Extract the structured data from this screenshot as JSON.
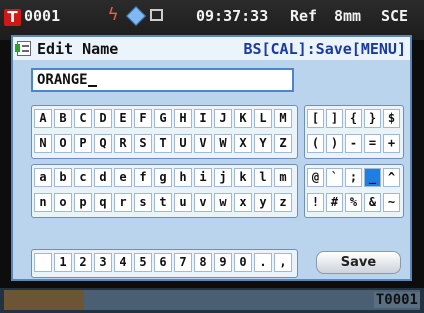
{
  "status_bar": {
    "badge": "T",
    "id": "0001",
    "time": "09:37:33",
    "ref": "Ref",
    "aperture": "8mm",
    "mode": "SCE",
    "icons": [
      "battery-lightning-icon",
      "diamond-sync-icon",
      "printer-icon"
    ],
    "colors": {
      "badge": "#d01818",
      "bolt": "#ff5555",
      "diamond": "#7fb8f2"
    }
  },
  "dialog": {
    "title": "Edit Name",
    "hint": "BS[CAL]:Save[MENU]",
    "name_value": "ORANGE",
    "save_label": "Save"
  },
  "keyboard": {
    "upper_row1": [
      "A",
      "B",
      "C",
      "D",
      "E",
      "F",
      "G",
      "H",
      "I",
      "J",
      "K",
      "L",
      "M"
    ],
    "upper_row2": [
      "N",
      "O",
      "P",
      "Q",
      "R",
      "S",
      "T",
      "U",
      "V",
      "W",
      "X",
      "Y",
      "Z"
    ],
    "lower_row1": [
      "a",
      "b",
      "c",
      "d",
      "e",
      "f",
      "g",
      "h",
      "i",
      "j",
      "k",
      "l",
      "m"
    ],
    "lower_row2": [
      "n",
      "o",
      "p",
      "q",
      "r",
      "s",
      "t",
      "u",
      "v",
      "w",
      "x",
      "y",
      "z"
    ],
    "digit_row": [
      " ",
      "1",
      "2",
      "3",
      "4",
      "5",
      "6",
      "7",
      "8",
      "9",
      "0",
      ".",
      ","
    ],
    "sym_row1": [
      "[",
      "]",
      "{",
      "}",
      "$"
    ],
    "sym_row2": [
      "(",
      ")",
      "-",
      "=",
      "+"
    ],
    "sym_row3": [
      "@",
      "`",
      ";",
      "_",
      "^"
    ],
    "sym_row4": [
      "!",
      "#",
      "%",
      "&",
      "~"
    ],
    "selected_key": "_",
    "colors": {
      "selected": "#1f7fe0",
      "panel": "#eaf2fa"
    }
  },
  "footer": {
    "code": "T0001",
    "swatch_color": "#6b5535"
  }
}
